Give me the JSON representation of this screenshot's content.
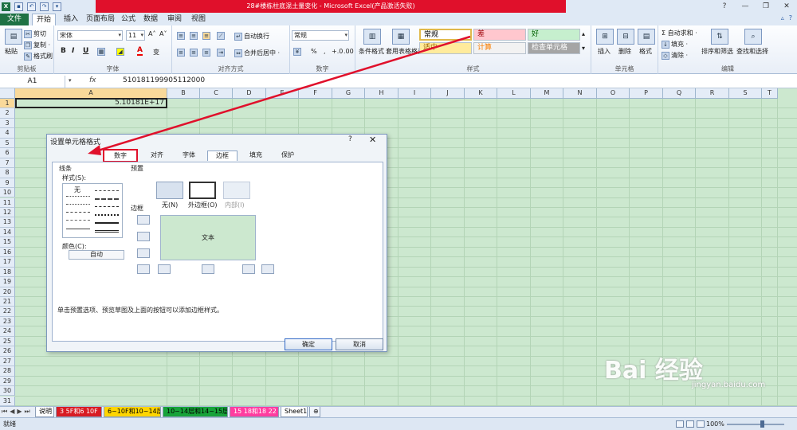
{
  "window": {
    "title": "28#楼栋柱底混土量变化 - Microsoft Excel(产品激活失败)",
    "controls": [
      "?",
      "—",
      "❐",
      "✕"
    ]
  },
  "ribbon_tabs": [
    "文件",
    "开始",
    "插入",
    "页面布局",
    "公式",
    "数据",
    "审阅",
    "视图"
  ],
  "clipboard": {
    "paste": "粘贴",
    "cut": "剪切",
    "copy": "复制 ·",
    "format_painter": "格式刷",
    "label": "剪贴板"
  },
  "font": {
    "name": "宋体",
    "size": "11",
    "label": "字体",
    "grow": "A˄",
    "shrink": "A˅",
    "bold": "B",
    "italic": "I",
    "underline": "U",
    "color_letter": "A",
    "wen": "变"
  },
  "alignment": {
    "wrap": "自动换行",
    "merge": "合并后居中 ·",
    "label": "对齐方式"
  },
  "number": {
    "format": "常规",
    "percent": "%",
    "comma": ",",
    "label": "数字",
    "inc": "+.0",
    "dec": ".00"
  },
  "styles": {
    "conditional": "条件格式",
    "table": "套用表格格式 ·",
    "cells": [
      {
        "label": "常规",
        "bg": "#ffffff",
        "color": "#000000"
      },
      {
        "label": "差",
        "bg": "#ffc7ce",
        "color": "#9c0006"
      },
      {
        "label": "好",
        "bg": "#c6efce",
        "color": "#006100"
      },
      {
        "label": "适中",
        "bg": "#ffeb9c",
        "color": "#9c6500"
      },
      {
        "label": "计算",
        "bg": "#f2f2f2",
        "color": "#fa7d00"
      },
      {
        "label": "检查单元格",
        "bg": "#a5a5a5",
        "color": "#ffffff"
      }
    ],
    "label": "样式"
  },
  "cells_group": {
    "insert": "插入",
    "delete": "删除",
    "format": "格式",
    "label": "单元格"
  },
  "editing": {
    "autosum": "Σ 自动求和 ·",
    "fill": "填充 ·",
    "clear": "清除 ·",
    "sort": "排序和筛选",
    "find": "查找和选择",
    "label": "编辑"
  },
  "formula_bar": {
    "name_box": "A1",
    "fx": "fx",
    "content": "510181199905112000"
  },
  "grid": {
    "columns": [
      "A",
      "B",
      "C",
      "D",
      "E",
      "F",
      "G",
      "H",
      "I",
      "J",
      "K",
      "L",
      "M",
      "N",
      "O",
      "P",
      "Q",
      "R",
      "S",
      "T"
    ],
    "rows": [
      "1",
      "2",
      "3",
      "4",
      "5",
      "6",
      "7",
      "8",
      "9",
      "10",
      "11",
      "12",
      "13",
      "14",
      "15",
      "16",
      "17",
      "18",
      "19",
      "20",
      "21",
      "22",
      "23",
      "24",
      "25",
      "26",
      "27",
      "28",
      "29",
      "30",
      "31"
    ],
    "A1_value": "5.10181E+17",
    "grid_bg": "#cce8cf"
  },
  "sheet_tabs": [
    {
      "label": "说明",
      "bg": "#ffffff",
      "color": "#000000"
    },
    {
      "label": "3 5F和6 10F",
      "bg": "#d81c23",
      "color": "#ffffff"
    },
    {
      "label": "6~10F和10~14层",
      "bg": "#ffd500",
      "color": "#000000"
    },
    {
      "label": "10~14层和14~15层",
      "bg": "#17a33a",
      "color": "#000000"
    },
    {
      "label": "15 18和18 22",
      "bg": "#ff3da0",
      "color": "#ffffff"
    },
    {
      "label": "Sheet1",
      "bg": "#ffffff",
      "color": "#000000"
    }
  ],
  "status": {
    "text": "就绪",
    "zoom": "100%"
  },
  "dialog": {
    "title": "设置单元格格式",
    "help": "?",
    "close": "✕",
    "tabs": [
      "数字",
      "对齐",
      "字体",
      "边框",
      "填充",
      "保护"
    ],
    "active_tab": "边框",
    "line_section": "线条",
    "style_label": "样式(S):",
    "style_none": "无",
    "color_label": "颜色(C):",
    "color_value": "自动",
    "preset_section": "预置",
    "presets": [
      "无(N)",
      "外边框(O)",
      "内部(I)"
    ],
    "border_section": "边框",
    "preview_text": "文本",
    "tip": "单击预置选项、预览草图及上面的按钮可以添加边框样式。",
    "ok": "确定",
    "cancel": "取消"
  },
  "annotation_color": "#e0102b",
  "watermark": {
    "brand": "Bai 经验",
    "url": "jingyan.baidu.com"
  }
}
